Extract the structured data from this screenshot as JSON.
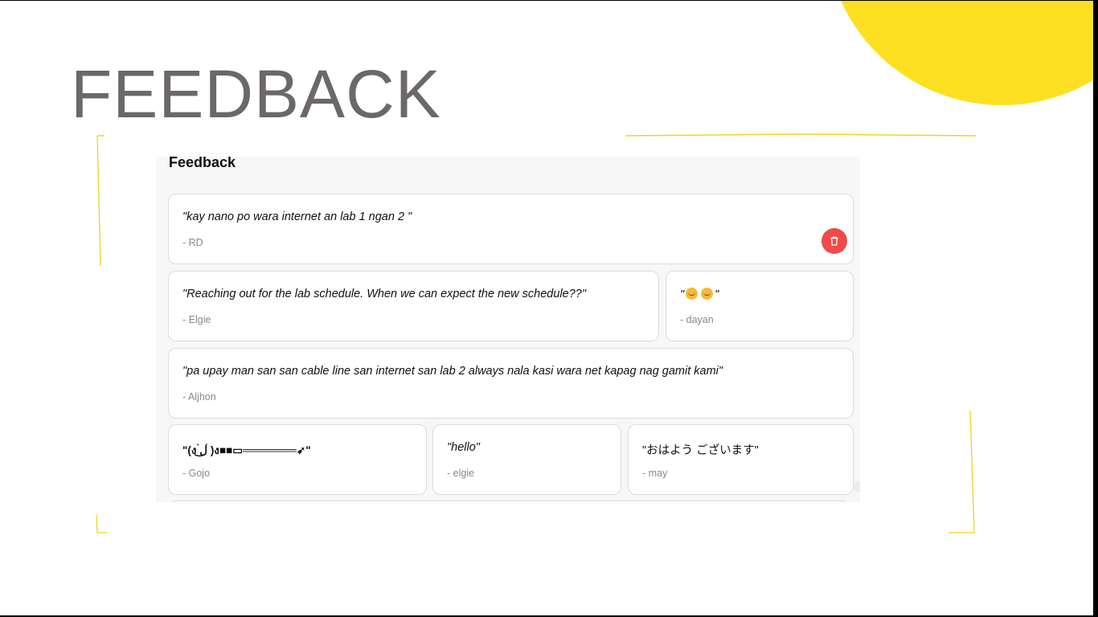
{
  "slide": {
    "title": "FEEDBACK",
    "accent_color": "#fde021",
    "title_color": "#6b6867"
  },
  "panel": {
    "heading": "Feedback",
    "delete_color": "#f04a4a",
    "cards": [
      {
        "quote": "\"kay nano po wara internet an lab 1 ngan 2 \"",
        "author": "- RD",
        "has_delete": true
      },
      {
        "quote": "\"Reaching out for the lab schedule. When we can expect the new schedule??\"",
        "author": "- Elgie"
      },
      {
        "quote_open": "\"",
        "quote_close": "\"",
        "emojis": [
          "smiling-face-icon",
          "smiling-face-icon"
        ],
        "author": "- dayan"
      },
      {
        "quote": "\"pa upay man san san cable line san internet san lab 2 always nala kasi wara net kapag nag gamit kami\"",
        "author": "- Aljhon"
      },
      {
        "quote": "\"(ง ̀ل͜ ́)ง■■▭═══════➶\"",
        "author": "- Gojo"
      },
      {
        "quote": "\"hello\"",
        "author": "- elgie"
      },
      {
        "quote": "\"おはよう ございます\"",
        "author": "- may"
      }
    ]
  }
}
